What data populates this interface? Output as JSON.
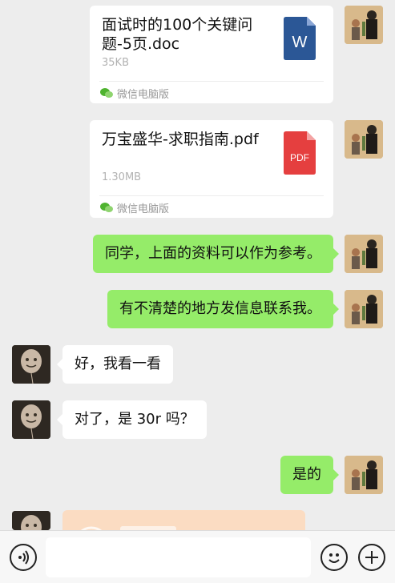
{
  "messages": {
    "file1": {
      "title": "面试时的100个关键问题-5页.doc",
      "size": "35KB",
      "source": "微信电脑版",
      "icon": "word-file-icon",
      "icon_label": "W",
      "icon_color": "#2b5796"
    },
    "file2": {
      "title": "万宝盛华-求职指南.pdf",
      "size": "1.30MB",
      "source": "微信电脑版",
      "icon": "pdf-file-icon",
      "icon_label": "PDF",
      "icon_color": "#e53f3f"
    },
    "msg1": "同学，上面的资料可以作为参考。",
    "msg2": "有不清楚的地方发信息联系我。",
    "msg3": "好，我看一看",
    "msg4": "对了，是 30r 吗？",
    "msg5": "是的"
  },
  "colors": {
    "bubble_green": "#95ec69",
    "bubble_white": "#ffffff",
    "background": "#ededed",
    "transfer_orange": "#fbdcc2"
  },
  "input_bar": {
    "text_value": "",
    "icons": [
      "voice-icon",
      "emoji-icon",
      "plus-icon"
    ]
  }
}
